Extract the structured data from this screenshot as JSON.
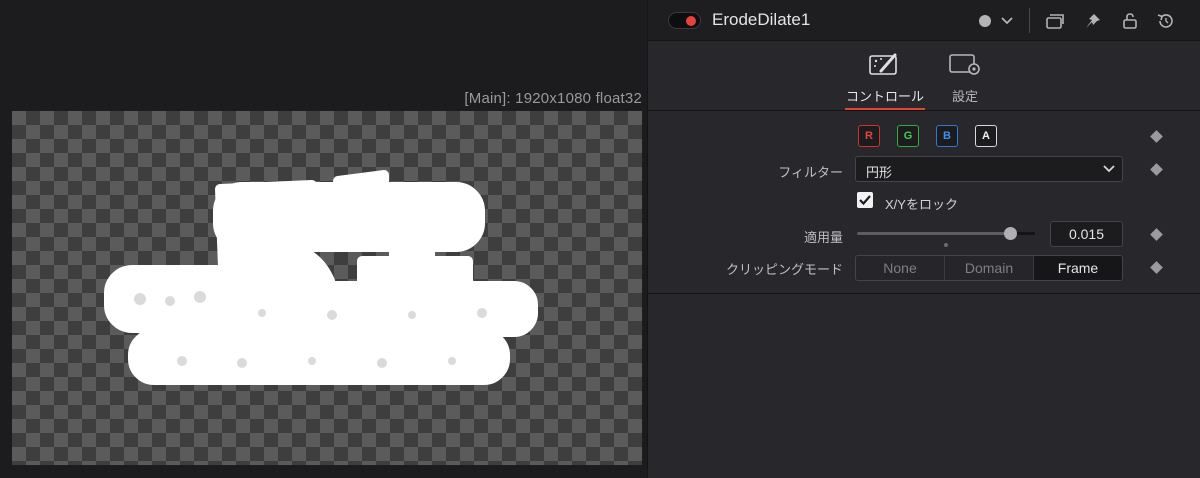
{
  "viewer": {
    "info": "[Main]: 1920x1080 float32"
  },
  "inspector": {
    "node_name": "ErodeDilate1",
    "header_icons": [
      "version-dot-icon",
      "chevron-down-icon",
      "versions-icon",
      "pin-icon",
      "lock-icon",
      "reset-icon"
    ],
    "tabs": [
      {
        "label": "コントロール",
        "icon": "controls-wand-icon",
        "active": true
      },
      {
        "label": "設定",
        "icon": "settings-gear-icon",
        "active": false
      }
    ],
    "channels": [
      "R",
      "G",
      "B",
      "A"
    ],
    "filter": {
      "label": "フィルター",
      "value": "円形"
    },
    "lock_xy": {
      "label": "X/Yをロック",
      "checked": true
    },
    "amount": {
      "label": "適用量",
      "value": "0.015",
      "slider_fraction": 0.86
    },
    "clipping": {
      "label": "クリッピングモード",
      "options": [
        "None",
        "Domain",
        "Frame"
      ],
      "selected": "Frame"
    },
    "colors": {
      "accent": "#e5433a",
      "channel_r": "#e6433c",
      "channel_g": "#3fd04a",
      "channel_b": "#3f8ef0",
      "channel_a": "#f0f0f4"
    }
  }
}
